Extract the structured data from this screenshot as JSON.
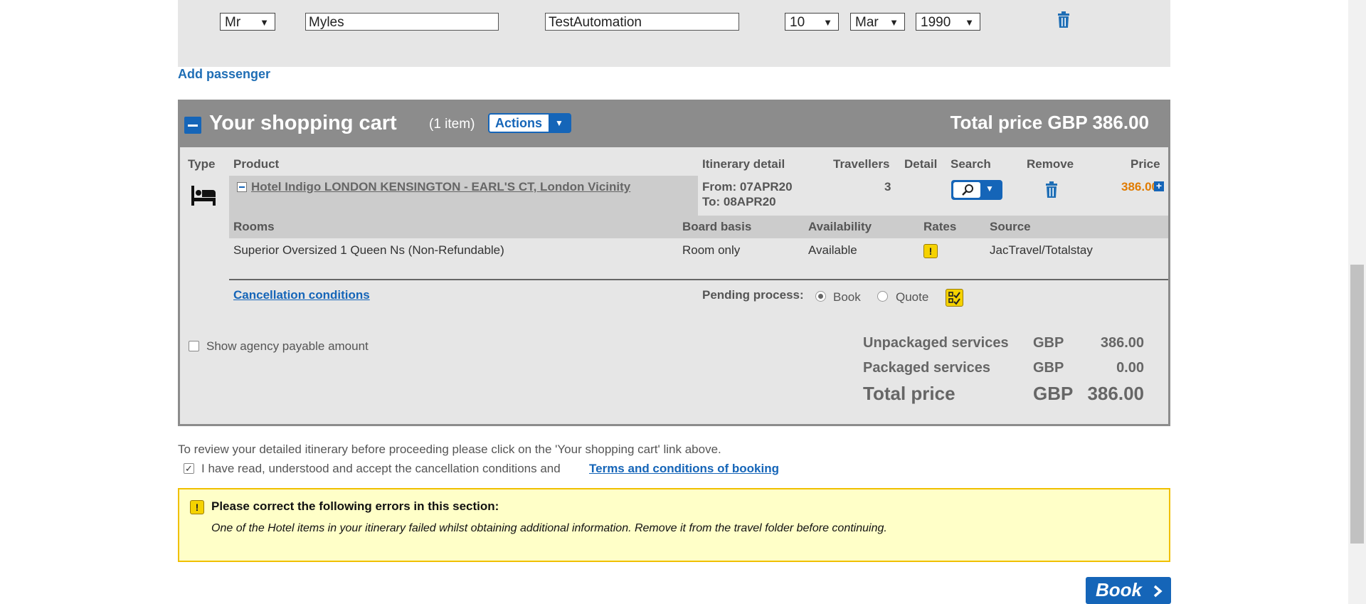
{
  "passenger": {
    "title": "Mr",
    "first_name": "Myles",
    "last_name": "TestAutomation",
    "dob_day": "10",
    "dob_month": "Mar",
    "dob_year": "1990"
  },
  "add_passenger_label": "Add passenger",
  "cart": {
    "title": "Your shopping cart",
    "item_count": "(1 item)",
    "actions_label": "Actions",
    "total_header": "Total price GBP 386.00",
    "columns": {
      "type": "Type",
      "product": "Product",
      "itinerary": "Itinerary detail",
      "travellers": "Travellers",
      "detail": "Detail",
      "search": "Search",
      "remove": "Remove",
      "price": "Price"
    },
    "item": {
      "product_name": "Hotel Indigo LONDON KENSINGTON - EARL'S CT, London Vicinity",
      "from": "From: 07APR20",
      "to": "To: 08APR20",
      "travellers": "3",
      "price": "386.00"
    },
    "room_columns": {
      "rooms": "Rooms",
      "board": "Board basis",
      "availability": "Availability",
      "rates": "Rates",
      "source": "Source"
    },
    "room": {
      "name": "Superior Oversized 1 Queen Ns (Non-Refundable)",
      "board": "Room only",
      "availability": "Available",
      "source": "JacTravel/Totalstay"
    },
    "cancellation_link": "Cancellation conditions",
    "pending_label": "Pending process:",
    "pending_options": [
      "Book",
      "Quote"
    ],
    "pending_selected": "Book",
    "agency_checkbox_label": "Show agency payable amount",
    "summary": [
      {
        "label": "Unpackaged services",
        "currency": "GBP",
        "amount": "386.00"
      },
      {
        "label": "Packaged services",
        "currency": "GBP",
        "amount": "0.00"
      },
      {
        "label": "Total price",
        "currency": "GBP",
        "amount": "386.00"
      }
    ]
  },
  "review_text": "To review your detailed itinerary before proceeding please click on the 'Your shopping cart' link above.",
  "terms": {
    "text": "I have read, understood and accept the cancellation conditions and",
    "link": "Terms and conditions of booking",
    "checked": true
  },
  "error": {
    "title": "Please correct the following errors in this section:",
    "message": "One of the Hotel items in your itinerary failed whilst obtaining additional information. Remove it from the travel folder before continuing."
  },
  "book_label": "Book",
  "colors": {
    "accent_blue": "#1565b8",
    "cart_header_grey": "#8c8c8c",
    "price_orange": "#e07b00",
    "warning_yellow": "#f5d200"
  },
  "icons": [
    "trash-icon",
    "bed-icon",
    "search-icon",
    "chevron-down-icon",
    "warning-icon",
    "plus-icon",
    "minus-icon",
    "checklist-icon",
    "chevron-right-icon"
  ]
}
